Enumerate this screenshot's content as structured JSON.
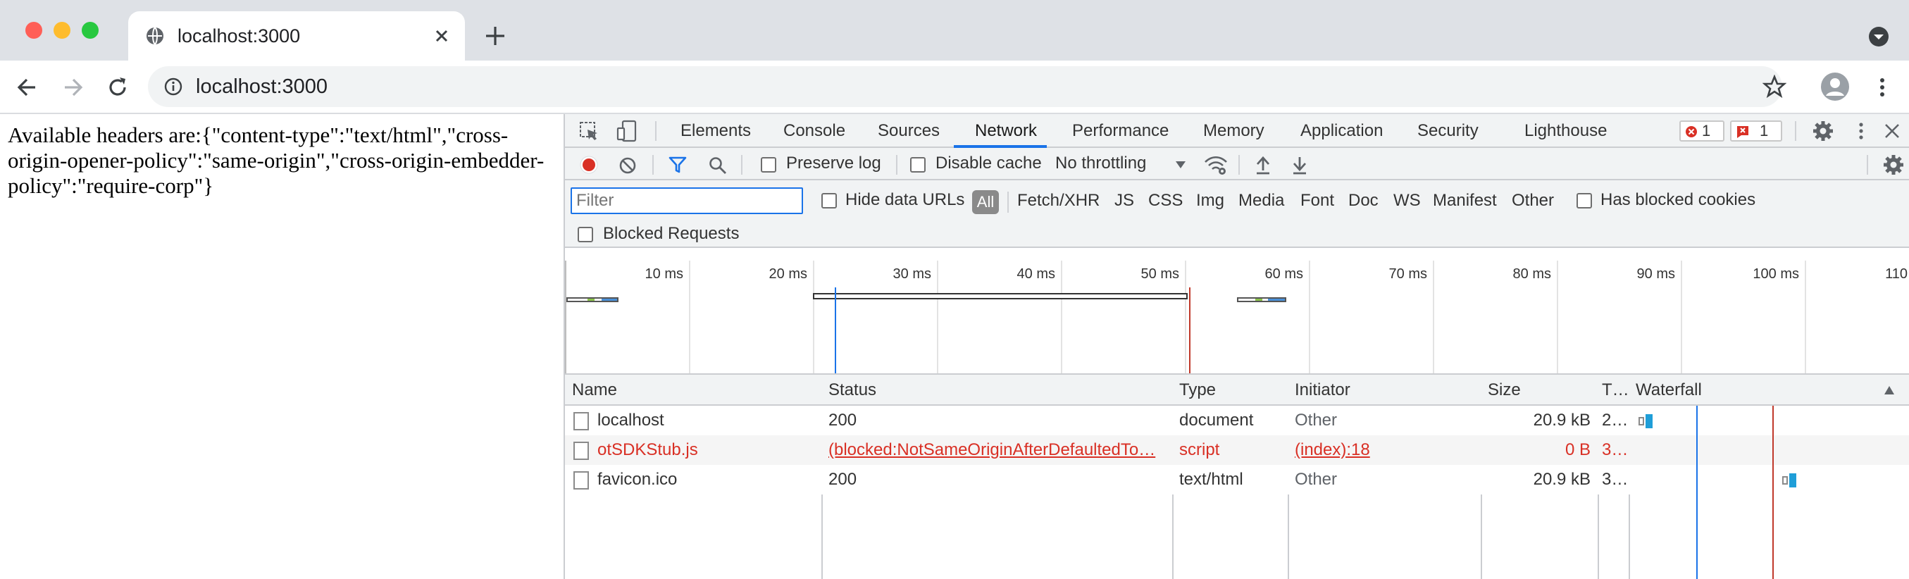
{
  "browser": {
    "tab_title": "localhost:3000",
    "url": "localhost:3000"
  },
  "page": {
    "text": "Available headers are:{\"content-type\":\"text/html\",\"cross-origin-opener-policy\":\"same-origin\",\"cross-origin-embedder-policy\":\"require-corp\"}"
  },
  "devtools": {
    "tabs": [
      "Elements",
      "Console",
      "Sources",
      "Network",
      "Performance",
      "Memory",
      "Application",
      "Security",
      "Lighthouse"
    ],
    "active_tab": "Network",
    "error_count": "1",
    "issue_count": "1",
    "network_toolbar": {
      "preserve_log": "Preserve log",
      "disable_cache": "Disable cache",
      "throttling": "No throttling"
    },
    "filter": {
      "placeholder": "Filter",
      "hide_data_urls": "Hide data URLs",
      "types": [
        "All",
        "Fetch/XHR",
        "JS",
        "CSS",
        "Img",
        "Media",
        "Font",
        "Doc",
        "WS",
        "Manifest",
        "Other"
      ],
      "has_blocked_cookies": "Has blocked cookies",
      "blocked_requests": "Blocked Requests"
    },
    "overview_ticks": [
      "10 ms",
      "20 ms",
      "30 ms",
      "40 ms",
      "50 ms",
      "60 ms",
      "70 ms",
      "80 ms",
      "90 ms",
      "100 ms",
      "110"
    ],
    "columns": [
      "Name",
      "Status",
      "Type",
      "Initiator",
      "Size",
      "T…",
      "Waterfall"
    ],
    "rows": [
      {
        "name": "localhost",
        "status": "200",
        "type": "document",
        "initiator": "Other",
        "size": "20.9 kB",
        "time": "2…",
        "error": false
      },
      {
        "name": "otSDKStub.js",
        "status": "(blocked:NotSameOriginAfterDefaultedTo…",
        "type": "script",
        "initiator": "(index):18",
        "size": "0 B",
        "time": "3…",
        "error": true
      },
      {
        "name": "favicon.ico",
        "status": "200",
        "type": "text/html",
        "initiator": "Other",
        "size": "20.9 kB",
        "time": "3…",
        "error": false
      }
    ]
  },
  "colors": {
    "accent": "#1a73e8",
    "error": "#d93025",
    "record": "#d93025"
  }
}
